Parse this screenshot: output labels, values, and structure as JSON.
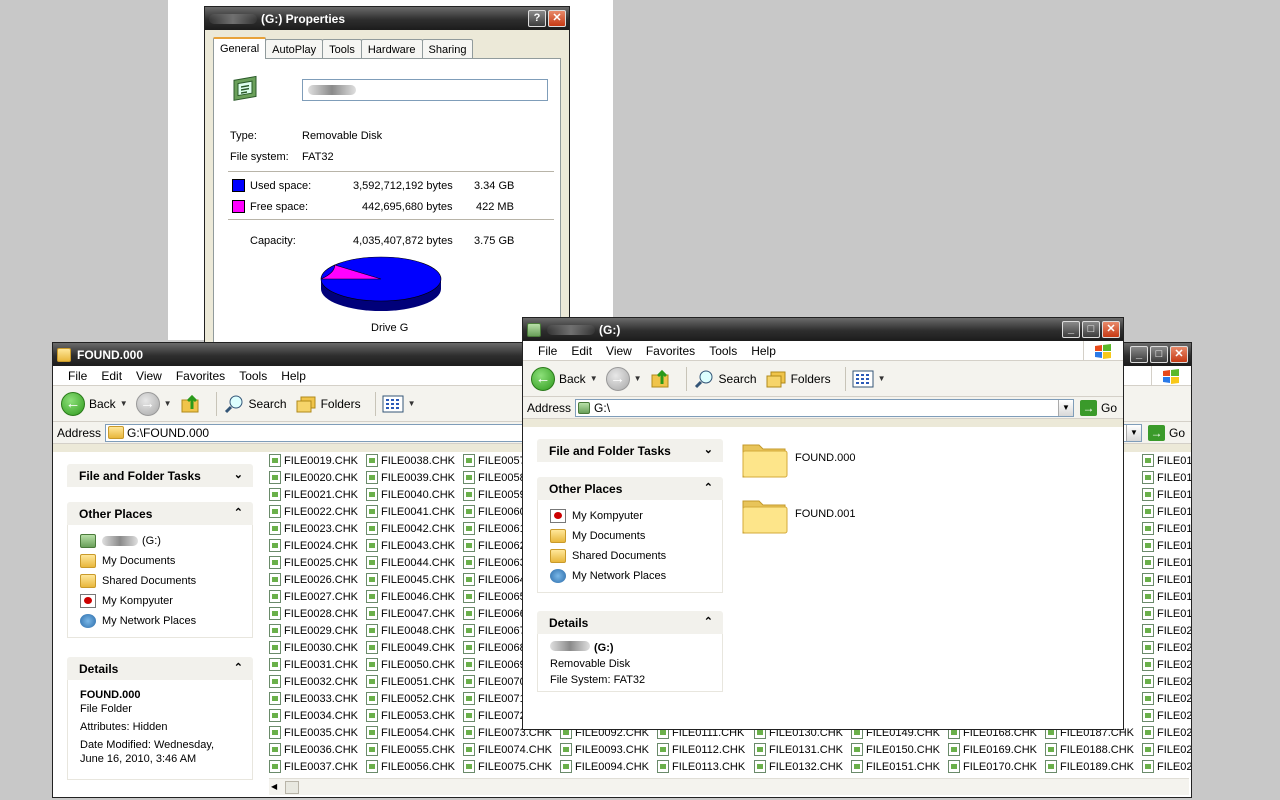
{
  "colors": {
    "used": "#0000ff",
    "free": "#ff00ff"
  },
  "props": {
    "title": "(G:) Properties",
    "tabs": [
      "General",
      "AutoPlay",
      "Tools",
      "Hardware",
      "Sharing"
    ],
    "type_label": "Type:",
    "type_value": "Removable Disk",
    "fs_label": "File system:",
    "fs_value": "FAT32",
    "used_label": "Used space:",
    "used_bytes": "3,592,712,192 bytes",
    "used_gb": "3.34 GB",
    "free_label": "Free space:",
    "free_bytes": "442,695,680 bytes",
    "free_mb": "422 MB",
    "cap_label": "Capacity:",
    "cap_bytes": "4,035,407,872 bytes",
    "cap_gb": "3.75 GB",
    "drive_label": "Drive G",
    "used_fraction": 0.89
  },
  "found": {
    "title": "FOUND.000",
    "menu": [
      "File",
      "Edit",
      "View",
      "Favorites",
      "Tools",
      "Help"
    ],
    "back": "Back",
    "search": "Search",
    "folders": "Folders",
    "address_label": "Address",
    "address": "G:\\FOUND.000",
    "go": "Go",
    "tasks_title": "File and Folder Tasks",
    "other_title": "Other Places",
    "other": [
      "(G:)",
      "My Documents",
      "Shared Documents",
      "My Kompyuter",
      "My Network Places"
    ],
    "details_title": "Details",
    "details_name": "FOUND.000",
    "details_type": "File Folder",
    "details_attr": "Attributes: Hidden",
    "details_date1": "Date Modified: Wednesday,",
    "details_date2": "June 16, 2010, 3:46 AM",
    "files": [
      [
        "FILE0019.CHK",
        "FILE0020.CHK",
        "FILE0021.CHK",
        "FILE0022.CHK",
        "FILE0023.CHK",
        "FILE0024.CHK",
        "FILE0025.CHK",
        "FILE0026.CHK",
        "FILE0027.CHK",
        "FILE0028.CHK",
        "FILE0029.CHK",
        "FILE0030.CHK",
        "FILE0031.CHK",
        "FILE0032.CHK",
        "FILE0033.CHK",
        "FILE0034.CHK",
        "FILE0035.CHK",
        "FILE0036.CHK",
        "FILE0037.CHK"
      ],
      [
        "FILE0038.CHK",
        "FILE0039.CHK",
        "FILE0040.CHK",
        "FILE0041.CHK",
        "FILE0042.CHK",
        "FILE0043.CHK",
        "FILE0044.CHK",
        "FILE0045.CHK",
        "FILE0046.CHK",
        "FILE0047.CHK",
        "FILE0048.CHK",
        "FILE0049.CHK",
        "FILE0050.CHK",
        "FILE0051.CHK",
        "FILE0052.CHK",
        "FILE0053.CHK",
        "FILE0054.CHK",
        "FILE0055.CHK",
        "FILE0056.CHK"
      ],
      [
        "FILE0057",
        "FILE0058",
        "FILE0059",
        "FILE0060",
        "FILE0061",
        "FILE0062",
        "FILE0063",
        "FILE0064",
        "FILE0065",
        "FILE0066",
        "FILE0067",
        "FILE0068",
        "FILE0069",
        "FILE0070",
        "FILE0071",
        "FILE0072",
        "FILE0073.CHK",
        "FILE0074.CHK",
        "FILE0075.CHK"
      ],
      [
        "",
        "",
        "",
        "",
        "",
        "",
        "",
        "",
        "",
        "",
        "",
        "",
        "",
        "",
        "",
        "",
        "FILE0092.CHK",
        "FILE0093.CHK",
        "FILE0094.CHK"
      ],
      [
        "",
        "",
        "",
        "",
        "",
        "",
        "",
        "",
        "",
        "",
        "",
        "",
        "",
        "",
        "",
        "",
        "FILE0111.CHK",
        "FILE0112.CHK",
        "FILE0113.CHK"
      ],
      [
        "",
        "",
        "",
        "",
        "",
        "",
        "",
        "",
        "",
        "",
        "",
        "",
        "",
        "",
        "",
        "",
        "FILE0130.CHK",
        "FILE0131.CHK",
        "FILE0132.CHK"
      ],
      [
        "",
        "",
        "",
        "",
        "",
        "",
        "",
        "",
        "",
        "",
        "",
        "",
        "",
        "",
        "",
        "",
        "FILE0149.CHK",
        "FILE0150.CHK",
        "FILE0151.CHK"
      ],
      [
        "",
        "",
        "",
        "",
        "",
        "",
        "",
        "",
        "",
        "",
        "",
        "",
        "",
        "",
        "",
        "",
        "FILE0168.CHK",
        "FILE0169.CHK",
        "FILE0170.CHK"
      ],
      [
        "",
        "",
        "",
        "",
        "",
        "",
        "",
        "",
        "",
        "",
        "",
        "",
        "",
        "",
        "",
        "",
        "FILE0187.CHK",
        "FILE0188.CHK",
        "FILE0189.CHK"
      ],
      [
        "FILE01",
        "FILE01",
        "FILE01",
        "FILE01",
        "FILE01",
        "FILE01",
        "FILE01",
        "FILE01",
        "FILE01",
        "FILE01",
        "FILE02",
        "FILE02",
        "FILE02",
        "FILE02",
        "FILE02",
        "FILE02",
        "FILE02",
        "FILE02",
        "FILE02"
      ]
    ]
  },
  "g": {
    "title": "(G:)",
    "menu": [
      "File",
      "Edit",
      "View",
      "Favorites",
      "Tools",
      "Help"
    ],
    "back": "Back",
    "search": "Search",
    "folders": "Folders",
    "address_label": "Address",
    "address": "G:\\",
    "go": "Go",
    "tasks_title": "File and Folder Tasks",
    "other_title": "Other Places",
    "other": [
      "My Kompyuter",
      "My Documents",
      "Shared Documents",
      "My Network Places"
    ],
    "details_title": "Details",
    "details_name": "(G:)",
    "details_type": "Removable Disk",
    "details_fs": "File System: FAT32",
    "folders_list": [
      "FOUND.000",
      "FOUND.001"
    ]
  }
}
